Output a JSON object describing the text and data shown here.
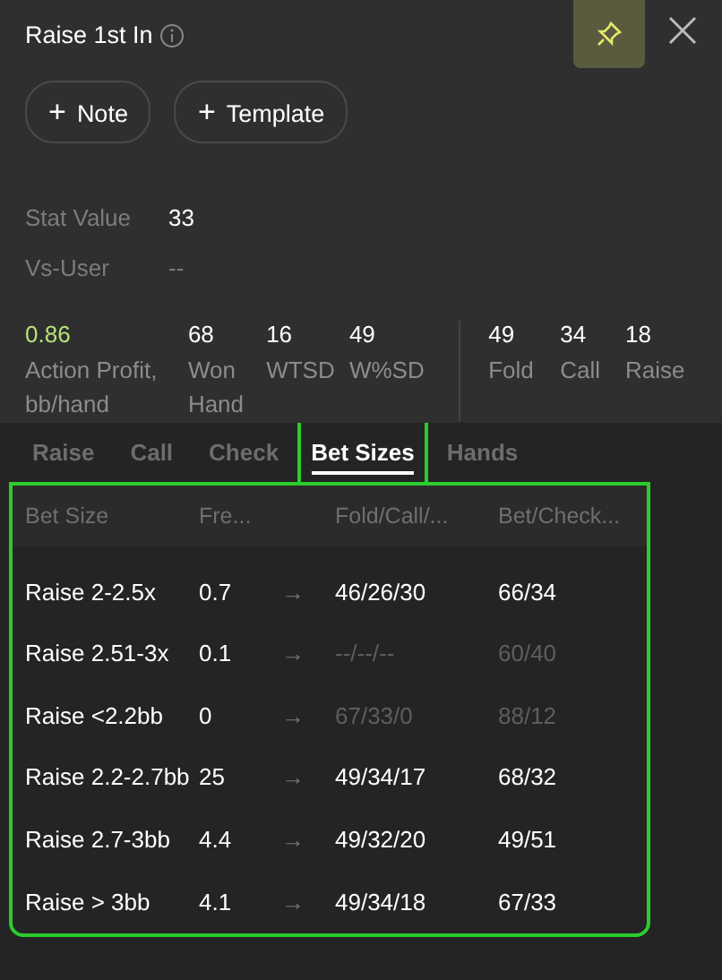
{
  "header": {
    "title": "Raise 1st In",
    "pinned": true
  },
  "actions": [
    {
      "icon": "+",
      "label": "Note"
    },
    {
      "icon": "+",
      "label": "Template"
    }
  ],
  "info": [
    {
      "label": "Stat Value",
      "value": "33",
      "dim": false
    },
    {
      "label": "Vs-User",
      "value": "--",
      "dim": true
    }
  ],
  "stats": [
    {
      "value": "0.86",
      "label": "Action Profit, bb/hand",
      "highlight": true
    },
    {
      "value": "68",
      "label": "Won Hand",
      "highlight": false
    },
    {
      "value": "16",
      "label": "WTSD",
      "highlight": false
    },
    {
      "value": "49",
      "label": "W%SD",
      "highlight": false
    }
  ],
  "response_stats": [
    {
      "value": "49",
      "label": "Fold"
    },
    {
      "value": "34",
      "label": "Call"
    },
    {
      "value": "18",
      "label": "Raise"
    }
  ],
  "tabs": [
    {
      "label": "Raise",
      "selected": false
    },
    {
      "label": "Call",
      "selected": false
    },
    {
      "label": "Check",
      "selected": false
    },
    {
      "label": "Bet Sizes",
      "selected": true
    },
    {
      "label": "Hands",
      "selected": false
    }
  ],
  "table": {
    "columns": [
      "Bet Size",
      "Fre...",
      "Fold/Call/...",
      "Bet/Check..."
    ],
    "rows": [
      {
        "size": "Raise 2-2.5x",
        "freq": "0.7",
        "arrow": "→",
        "fcr": "46/26/30",
        "fcr_dim": false,
        "bc": "66/34",
        "bc_dim": false
      },
      {
        "size": "Raise 2.51-3x",
        "freq": "0.1",
        "arrow": "→",
        "fcr": "--/--/--",
        "fcr_dim": true,
        "bc": "60/40",
        "bc_dim": true
      },
      {
        "size": "Raise <2.2bb",
        "freq": "0",
        "arrow": "→",
        "fcr": "67/33/0",
        "fcr_dim": true,
        "bc": "88/12",
        "bc_dim": true
      },
      {
        "size": "Raise 2.2-2.7bb",
        "freq": "25",
        "arrow": "→",
        "fcr": "49/34/17",
        "fcr_dim": false,
        "bc": "68/32",
        "bc_dim": false
      },
      {
        "size": "Raise 2.7-3bb",
        "freq": "4.4",
        "arrow": "→",
        "fcr": "49/32/20",
        "fcr_dim": false,
        "bc": "49/51",
        "bc_dim": false
      },
      {
        "size": "Raise > 3bb",
        "freq": "4.1",
        "arrow": "→",
        "fcr": "49/34/18",
        "fcr_dim": false,
        "bc": "67/33",
        "bc_dim": false
      }
    ]
  }
}
